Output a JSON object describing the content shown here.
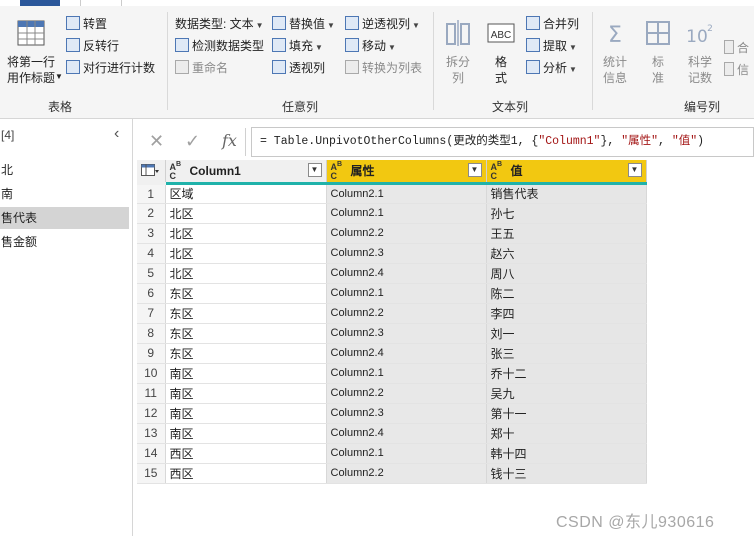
{
  "ribbon": {
    "table_group": {
      "label": "表格",
      "first_row_header": "将第一行\n用作标题",
      "transpose": "转置",
      "reverse_rows": "反转行",
      "count_rows": "对行进行计数"
    },
    "any_column_group": {
      "label": "任意列",
      "data_type": "数据类型: 文本",
      "detect_type": "检测数据类型",
      "rename": "重命名",
      "replace_values": "替换值",
      "fill": "填充",
      "pivot_column": "透视列",
      "unpivot_columns": "逆透视列",
      "move": "移动",
      "convert_to_list": "转换为列表"
    },
    "text_column_group": {
      "label": "文本列",
      "split_column": "拆分\n列",
      "format": "格\n式",
      "merge_columns": "合并列",
      "extract": "提取",
      "parse": "分析"
    },
    "number_column_group": {
      "label": "编号列",
      "statistics": "统计\n信息",
      "standard": "标\n准",
      "scientific": "科学\n记数",
      "trig_partial": "合",
      "info_partial": "信"
    }
  },
  "left_pane": {
    "header": "[4]",
    "collapse_icon": "chevron-left",
    "items": [
      {
        "label": "北",
        "selected": false
      },
      {
        "label": "南",
        "selected": false
      },
      {
        "label": "售代表",
        "selected": true
      },
      {
        "label": "售金额",
        "selected": false
      }
    ]
  },
  "formula_bar": {
    "formula_prefix": "= Table.UnpivotOtherColumns(更改的类型1, {",
    "str1": "\"Column1\"",
    "mid": "}, ",
    "str2": "\"属性\"",
    "mid2": ", ",
    "str3": "\"值\"",
    "suffix": ")"
  },
  "grid": {
    "columns": [
      {
        "name": "Column1",
        "type": "text",
        "selected": false
      },
      {
        "name": "属性",
        "type": "text",
        "selected": true
      },
      {
        "name": "值",
        "type": "text",
        "selected": true
      }
    ],
    "rows": [
      [
        "1",
        "区域",
        "Column2.1",
        "销售代表"
      ],
      [
        "2",
        "北区",
        "Column2.1",
        "孙七"
      ],
      [
        "3",
        "北区",
        "Column2.2",
        "王五"
      ],
      [
        "4",
        "北区",
        "Column2.3",
        "赵六"
      ],
      [
        "5",
        "北区",
        "Column2.4",
        "周八"
      ],
      [
        "6",
        "东区",
        "Column2.1",
        "陈二"
      ],
      [
        "7",
        "东区",
        "Column2.2",
        "李四"
      ],
      [
        "8",
        "东区",
        "Column2.3",
        "刘一"
      ],
      [
        "9",
        "东区",
        "Column2.4",
        "张三"
      ],
      [
        "10",
        "南区",
        "Column2.1",
        "乔十二"
      ],
      [
        "11",
        "南区",
        "Column2.2",
        "吴九"
      ],
      [
        "12",
        "南区",
        "Column2.3",
        "第十一"
      ],
      [
        "13",
        "南区",
        "Column2.4",
        "郑十"
      ],
      [
        "14",
        "西区",
        "Column2.1",
        "韩十四"
      ],
      [
        "15",
        "西区",
        "Column2.2",
        "钱十三"
      ]
    ]
  },
  "watermark": "CSDN @东儿930616",
  "colors": {
    "selected_header": "#f2c811",
    "quality_bar": "#20b2aa",
    "ribbon_bg": "#f5f5f5",
    "tab_accent": "#2b579a"
  }
}
